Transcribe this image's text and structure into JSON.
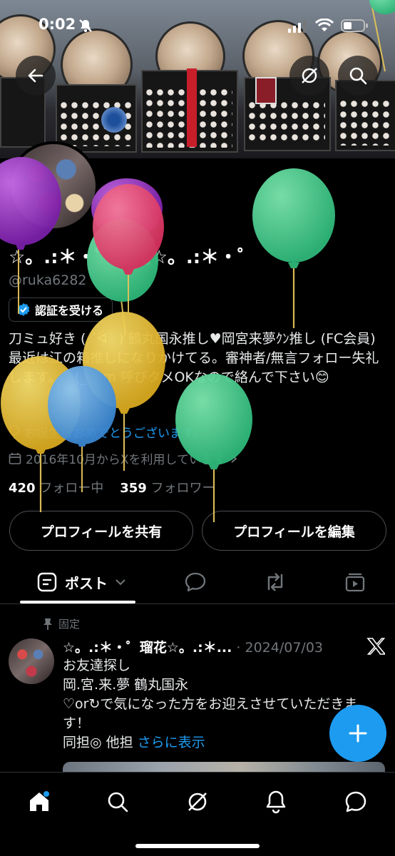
{
  "status_bar": {
    "time": "0:02"
  },
  "profile": {
    "display_name": "☆。.:＊・゜瑠花☆。.:＊・゜",
    "handle": "@ruka6282",
    "verify_label": "認証を受ける",
    "bio": "刀ミュ好き ( ´ᐛ` )  鶴丸国永推し♥岡宮来夢ｸﾝ推し (FC会員) 最近は江の箱推しになりかけてる。審神者/無言フォロー失礼します。m(_ _)m 呼びタメOKなので絡んで下さい😊",
    "birthday_text": "お誕生日おめでとうございます。",
    "joined_text": "2016年10月からXを利用しています",
    "following_count": "420",
    "following_label": "フォロー中",
    "followers_count": "359",
    "followers_label": "フォロワー",
    "share_button": "プロフィールを共有",
    "edit_button": "プロフィールを編集"
  },
  "tabs": {
    "posts_label": "ポスト"
  },
  "post": {
    "pinned_label": "固定",
    "author": "☆。.:＊・゜瑠花☆。.:＊...",
    "date": "· 2024/07/03",
    "lines": [
      "お友達探し",
      "岡.宮.来.夢  鶴丸国永",
      "♡or↻で気になった方をお迎えさせていただきます！",
      "同担◎  他担"
    ],
    "show_more": "さらに表示"
  },
  "colors": {
    "accent": "#1d9bf0",
    "muted": "#71767b"
  },
  "icons": [
    "back-arrow-icon",
    "grok-icon",
    "search-icon",
    "verified-badge-icon",
    "balloon-icon",
    "calendar-icon",
    "chevron-right-icon",
    "compose-icon",
    "reply-icon",
    "repost-icon",
    "media-icon",
    "pin-icon",
    "x-logo-icon",
    "plus-icon",
    "home-icon",
    "search-icon",
    "grok-icon",
    "bell-icon",
    "messages-icon"
  ]
}
